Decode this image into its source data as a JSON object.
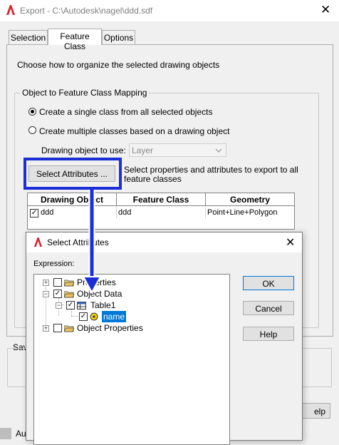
{
  "window": {
    "title": "Export - C:\\Autodesk\\nagel\\ddd.sdf",
    "close_glyph": "✕"
  },
  "tabs": [
    {
      "label": "Selection",
      "active": false
    },
    {
      "label": "Feature Class",
      "active": true
    },
    {
      "label": "Options",
      "active": false
    }
  ],
  "feature_class": {
    "instruction": "Choose how to organize the selected drawing objects",
    "group_label": "Object to Feature Class Mapping",
    "radio_single": "Create a single class from all selected objects",
    "radio_multiple": "Create multiple classes based on a drawing object",
    "selected_radio": "single",
    "drawing_object_label": "Drawing object to use:",
    "drawing_object_value": "Layer",
    "select_attributes_button": "Select Attributes ...",
    "select_attributes_hint": "Select properties and attributes to export to all feature classes",
    "table": {
      "headers": [
        "Drawing Object",
        "Feature Class",
        "Geometry"
      ],
      "rows": [
        {
          "checked": true,
          "drawing_object": "ddd",
          "feature_class": "ddd",
          "geometry": "Point+Line+Polygon"
        }
      ]
    }
  },
  "bottom_partial": {
    "save_label_fragment": "Sav",
    "help_fragment": "elp",
    "status_fragment": "Au"
  },
  "dialog": {
    "title": "Select Attributes",
    "close_glyph": "✕",
    "expression_label": "Expression:",
    "tree": [
      {
        "label": "Properties",
        "expander": "+",
        "checked": false,
        "level": 0
      },
      {
        "label": "Object Data",
        "expander": "−",
        "checked": true,
        "level": 0
      },
      {
        "label": "Table1",
        "expander": "−",
        "checked": true,
        "level": 1
      },
      {
        "label": "name",
        "expander": "",
        "checked": true,
        "level": 2,
        "selected": true
      },
      {
        "label": "Object Properties",
        "expander": "+",
        "checked": false,
        "level": 0
      }
    ],
    "buttons": {
      "ok": "OK",
      "cancel": "Cancel",
      "help": "Help"
    }
  },
  "colors": {
    "highlight_frame": "#1c2fd6",
    "selection": "#0078d7",
    "autocad_red": "#d6202e"
  }
}
